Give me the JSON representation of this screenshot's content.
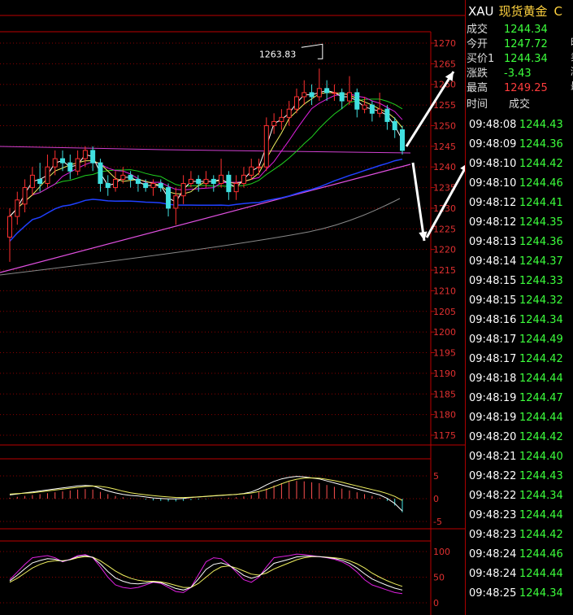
{
  "quote": {
    "symbol": "XAU",
    "name": "现货黄金",
    "extra": "C",
    "rows": [
      {
        "label": "成交",
        "value": "1244.34",
        "color": "#3cff3c",
        "tag": ""
      },
      {
        "label": "今开",
        "value": "1247.72",
        "color": "#3cff3c",
        "tag": "昨"
      },
      {
        "label": "买价1",
        "value": "1244.34",
        "color": "#3cff3c",
        "tag": "卖"
      },
      {
        "label": "涨跌",
        "value": "-3.43",
        "color": "#3cff3c",
        "tag": "涨"
      },
      {
        "label": "最高",
        "value": "1249.25",
        "color": "#ff3c3c",
        "tag": "最"
      }
    ]
  },
  "ticks_header": {
    "time": "时间",
    "price": "成交"
  },
  "ticks": [
    {
      "time": "09:48:08",
      "price": "1244.43"
    },
    {
      "time": "09:48:09",
      "price": "1244.36"
    },
    {
      "time": "09:48:10",
      "price": "1244.42"
    },
    {
      "time": "09:48:10",
      "price": "1244.46"
    },
    {
      "time": "09:48:12",
      "price": "1244.41"
    },
    {
      "time": "09:48:12",
      "price": "1244.35"
    },
    {
      "time": "09:48:13",
      "price": "1244.36"
    },
    {
      "time": "09:48:14",
      "price": "1244.37"
    },
    {
      "time": "09:48:15",
      "price": "1244.33"
    },
    {
      "time": "09:48:15",
      "price": "1244.32"
    },
    {
      "time": "09:48:16",
      "price": "1244.34"
    },
    {
      "time": "09:48:17",
      "price": "1244.49"
    },
    {
      "time": "09:48:17",
      "price": "1244.42"
    },
    {
      "time": "09:48:18",
      "price": "1244.44"
    },
    {
      "time": "09:48:19",
      "price": "1244.47"
    },
    {
      "time": "09:48:19",
      "price": "1244.44"
    },
    {
      "time": "09:48:20",
      "price": "1244.42"
    },
    {
      "time": "09:48:21",
      "price": "1244.40"
    },
    {
      "time": "09:48:22",
      "price": "1244.43"
    },
    {
      "time": "09:48:22",
      "price": "1244.34"
    },
    {
      "time": "09:48:23",
      "price": "1244.44"
    },
    {
      "time": "09:48:23",
      "price": "1244.42"
    },
    {
      "time": "09:48:24",
      "price": "1244.46"
    },
    {
      "time": "09:48:24",
      "price": "1244.44"
    },
    {
      "time": "09:48:25",
      "price": "1244.34"
    }
  ],
  "chart_data": {
    "type": "candlestick",
    "price_ticks": [
      1270,
      1265,
      1260,
      1255,
      1250,
      1245,
      1240,
      1235,
      1230,
      1225,
      1220,
      1215,
      1210,
      1205,
      1200,
      1195,
      1190,
      1185,
      1180,
      1175
    ],
    "peak_label": "1263.83",
    "candles": [
      {
        "o": 1223,
        "c": 1228,
        "h": 1230,
        "l": 1217
      },
      {
        "o": 1228,
        "c": 1232,
        "h": 1234,
        "l": 1226
      },
      {
        "o": 1231,
        "c": 1235,
        "h": 1237,
        "l": 1229
      },
      {
        "o": 1235,
        "c": 1238,
        "h": 1240,
        "l": 1233
      },
      {
        "o": 1237,
        "c": 1236,
        "h": 1241,
        "l": 1234
      },
      {
        "o": 1236,
        "c": 1240,
        "h": 1243,
        "l": 1235
      },
      {
        "o": 1240,
        "c": 1242,
        "h": 1244,
        "l": 1238
      },
      {
        "o": 1242,
        "c": 1241,
        "h": 1244,
        "l": 1239
      },
      {
        "o": 1241,
        "c": 1239,
        "h": 1243,
        "l": 1237
      },
      {
        "o": 1239,
        "c": 1242,
        "h": 1244,
        "l": 1238
      },
      {
        "o": 1242,
        "c": 1244,
        "h": 1245,
        "l": 1240
      },
      {
        "o": 1244,
        "c": 1241,
        "h": 1245,
        "l": 1239
      },
      {
        "o": 1241,
        "c": 1236,
        "h": 1242,
        "l": 1234
      },
      {
        "o": 1236,
        "c": 1235,
        "h": 1238,
        "l": 1233
      },
      {
        "o": 1235,
        "c": 1237,
        "h": 1239,
        "l": 1234
      },
      {
        "o": 1237,
        "c": 1238,
        "h": 1240,
        "l": 1236
      },
      {
        "o": 1238,
        "c": 1237,
        "h": 1239,
        "l": 1235
      },
      {
        "o": 1237,
        "c": 1236,
        "h": 1238,
        "l": 1234
      },
      {
        "o": 1236,
        "c": 1235,
        "h": 1237,
        "l": 1234
      },
      {
        "o": 1235,
        "c": 1236,
        "h": 1237,
        "l": 1233
      },
      {
        "o": 1236,
        "c": 1235,
        "h": 1237,
        "l": 1234
      },
      {
        "o": 1235,
        "c": 1230,
        "h": 1236,
        "l": 1228
      },
      {
        "o": 1230,
        "c": 1233,
        "h": 1235,
        "l": 1226
      },
      {
        "o": 1233,
        "c": 1236,
        "h": 1238,
        "l": 1231
      },
      {
        "o": 1236,
        "c": 1237,
        "h": 1239,
        "l": 1235
      },
      {
        "o": 1237,
        "c": 1236,
        "h": 1238,
        "l": 1234
      },
      {
        "o": 1236,
        "c": 1237,
        "h": 1239,
        "l": 1235
      },
      {
        "o": 1237,
        "c": 1236,
        "h": 1238,
        "l": 1234
      },
      {
        "o": 1236,
        "c": 1238,
        "h": 1242,
        "l": 1235
      },
      {
        "o": 1238,
        "c": 1234,
        "h": 1239,
        "l": 1232
      },
      {
        "o": 1234,
        "c": 1236,
        "h": 1238,
        "l": 1232
      },
      {
        "o": 1236,
        "c": 1238,
        "h": 1240,
        "l": 1235
      },
      {
        "o": 1238,
        "c": 1240,
        "h": 1242,
        "l": 1237
      },
      {
        "o": 1240,
        "c": 1240,
        "h": 1242,
        "l": 1238
      },
      {
        "o": 1240,
        "c": 1250,
        "h": 1252,
        "l": 1239
      },
      {
        "o": 1250,
        "c": 1251,
        "h": 1253,
        "l": 1248
      },
      {
        "o": 1251,
        "c": 1252,
        "h": 1254,
        "l": 1249
      },
      {
        "o": 1252,
        "c": 1254,
        "h": 1256,
        "l": 1250
      },
      {
        "o": 1254,
        "c": 1257,
        "h": 1259,
        "l": 1253
      },
      {
        "o": 1257,
        "c": 1258,
        "h": 1261,
        "l": 1255
      },
      {
        "o": 1258,
        "c": 1257,
        "h": 1260,
        "l": 1255
      },
      {
        "o": 1257,
        "c": 1259,
        "h": 1263.83,
        "l": 1256
      },
      {
        "o": 1259,
        "c": 1258,
        "h": 1261,
        "l": 1256
      },
      {
        "o": 1258,
        "c": 1258,
        "h": 1260,
        "l": 1256
      },
      {
        "o": 1258,
        "c": 1256,
        "h": 1259,
        "l": 1254
      },
      {
        "o": 1256,
        "c": 1258,
        "h": 1262,
        "l": 1255
      },
      {
        "o": 1258,
        "c": 1254,
        "h": 1259,
        "l": 1252
      },
      {
        "o": 1254,
        "c": 1255,
        "h": 1257,
        "l": 1253
      },
      {
        "o": 1255,
        "c": 1253,
        "h": 1256,
        "l": 1251
      },
      {
        "o": 1253,
        "c": 1254,
        "h": 1258,
        "l": 1252
      },
      {
        "o": 1254,
        "c": 1251,
        "h": 1255,
        "l": 1249
      },
      {
        "o": 1251,
        "c": 1249,
        "h": 1252,
        "l": 1247
      },
      {
        "o": 1249,
        "c": 1244,
        "h": 1250,
        "l": 1243
      }
    ],
    "macd_ticks": [
      5,
      0,
      -5
    ],
    "macd_hist": [
      0.2,
      0.4,
      0.6,
      0.8,
      1.0,
      1.2,
      1.4,
      1.6,
      1.8,
      2.0,
      2.1,
      2.0,
      1.5,
      1.0,
      0.6,
      0.3,
      0.1,
      0.0,
      -0.2,
      -0.4,
      -0.5,
      -0.6,
      -0.6,
      -0.5,
      -0.3,
      -0.2,
      -0.1,
      0,
      0.1,
      0.2,
      0.3,
      0.5,
      0.8,
      1.4,
      2.2,
      2.9,
      3.4,
      3.7,
      3.9,
      3.8,
      3.6,
      3.4,
      3.0,
      2.6,
      2.2,
      1.8,
      1.4,
      1.0,
      0.6,
      0.2,
      -0.5,
      -1.5,
      -3.0
    ],
    "kdj_ticks": [
      100,
      50,
      0
    ],
    "kdj_k": [
      45,
      60,
      75,
      88,
      90,
      92,
      88,
      80,
      85,
      92,
      94,
      88,
      70,
      50,
      35,
      30,
      28,
      30,
      35,
      40,
      38,
      30,
      22,
      20,
      30,
      55,
      80,
      88,
      86,
      75,
      60,
      45,
      40,
      50,
      70,
      88,
      90,
      92,
      95,
      94,
      92,
      90,
      88,
      85,
      80,
      72,
      60,
      45,
      35,
      30,
      25,
      20,
      18
    ],
    "kdj_d": [
      40,
      48,
      58,
      68,
      75,
      80,
      82,
      82,
      84,
      88,
      90,
      89,
      82,
      72,
      62,
      54,
      48,
      44,
      42,
      42,
      41,
      38,
      34,
      30,
      30,
      38,
      50,
      62,
      70,
      72,
      68,
      62,
      56,
      54,
      58,
      66,
      72,
      78,
      84,
      88,
      90,
      90,
      89,
      88,
      86,
      82,
      76,
      68,
      58,
      50,
      43,
      37,
      32
    ]
  }
}
